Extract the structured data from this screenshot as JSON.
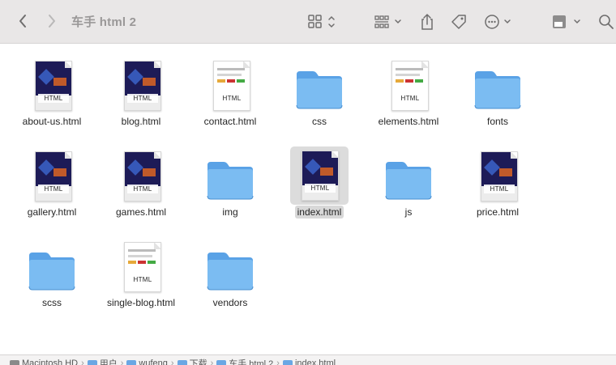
{
  "window": {
    "title": "车手 html 2"
  },
  "toolbar": {
    "back": "chevron-left-icon",
    "forward": "chevron-right-icon",
    "view": "icon-grid-view-icon",
    "group": "group-by-icon",
    "share": "share-icon",
    "tags": "tag-icon",
    "more": "more-options-icon",
    "preview": "preview-icon",
    "search": "search-icon"
  },
  "files": [
    {
      "name": "about-us.html",
      "kind": "html",
      "theme": "dark"
    },
    {
      "name": "blog.html",
      "kind": "html",
      "theme": "dark"
    },
    {
      "name": "contact.html",
      "kind": "html",
      "theme": "light"
    },
    {
      "name": "css",
      "kind": "folder"
    },
    {
      "name": "elements.html",
      "kind": "html",
      "theme": "light"
    },
    {
      "name": "fonts",
      "kind": "folder"
    },
    {
      "name": "gallery.html",
      "kind": "html",
      "theme": "dark"
    },
    {
      "name": "games.html",
      "kind": "html",
      "theme": "dark"
    },
    {
      "name": "img",
      "kind": "folder"
    },
    {
      "name": "index.html",
      "kind": "html",
      "theme": "dark",
      "selected": true
    },
    {
      "name": "js",
      "kind": "folder"
    },
    {
      "name": "price.html",
      "kind": "html",
      "theme": "dark"
    },
    {
      "name": "scss",
      "kind": "folder"
    },
    {
      "name": "single-blog.html",
      "kind": "html",
      "theme": "light"
    },
    {
      "name": "vendors",
      "kind": "folder"
    }
  ],
  "badge_text": "HTML",
  "pathbar": {
    "items": [
      "Macintosh HD",
      "用户",
      "wufeng",
      "下载",
      "车手 html 2",
      "index.html"
    ]
  },
  "colors": {
    "folder_back": "#5aa2e6",
    "folder_front": "#7bbcf2",
    "page_dark": "#1d1b57",
    "selection": "#d8d8d8"
  }
}
